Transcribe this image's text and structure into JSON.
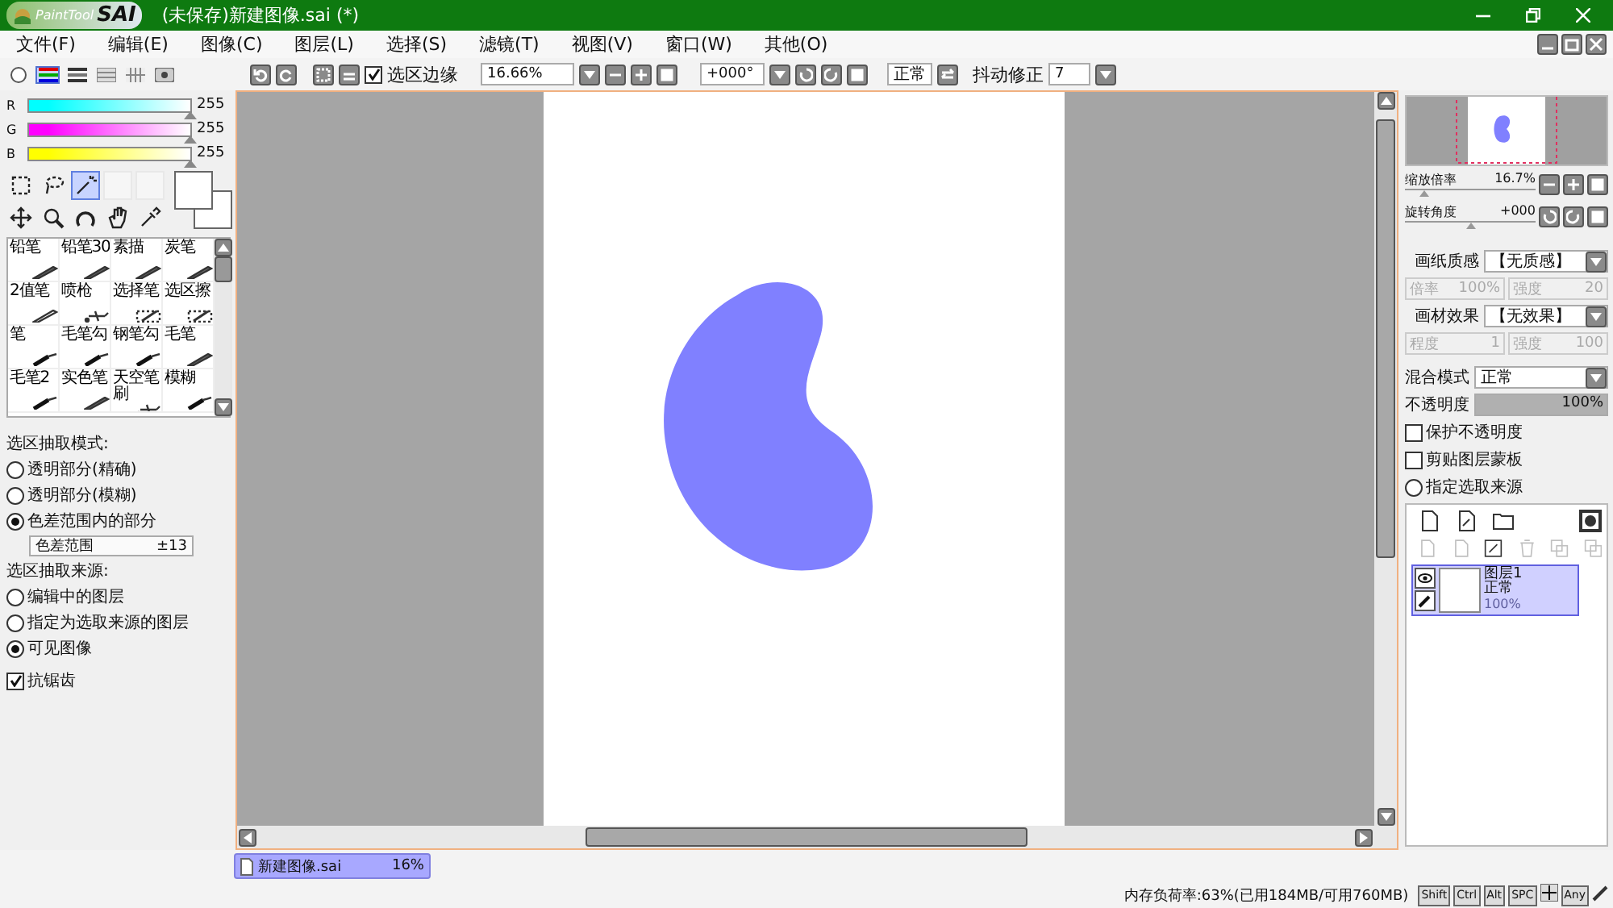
{
  "window": {
    "logo_text": "PaintTool",
    "logo_name": "SAI",
    "title": "(未保存)新建图像.sai (*)"
  },
  "menu": [
    "文件(F)",
    "编辑(E)",
    "图像(C)",
    "图层(L)",
    "选择(S)",
    "滤镜(T)",
    "视图(V)",
    "窗口(W)",
    "其他(O)"
  ],
  "toolbar": {
    "show_selection": {
      "label": "选区边缘",
      "checked": true
    },
    "zoom": "16.66%",
    "rotation": "+000°",
    "blend": "正常",
    "stabilizer": {
      "label": "抖动修正",
      "value": "7"
    }
  },
  "color_modes": [
    {
      "kind": "wheel",
      "selected": false
    },
    {
      "kind": "rgb",
      "selected": true
    },
    {
      "kind": "hsv",
      "selected": false
    },
    {
      "kind": "mixer",
      "selected": false
    },
    {
      "kind": "swatch",
      "selected": false
    },
    {
      "kind": "scratch",
      "selected": false
    }
  ],
  "rgb": [
    {
      "name": "R",
      "level": 1,
      "reading": "255",
      "color": "#00ffff"
    },
    {
      "name": "G",
      "level": 1,
      "reading": "255",
      "color": "#ff00ff"
    },
    {
      "name": "B",
      "level": 1,
      "reading": "255",
      "color": "#ffff00"
    }
  ],
  "tools": [
    {
      "kind": "rect-select",
      "selected": false
    },
    {
      "kind": "lasso",
      "selected": false
    },
    {
      "kind": "wand",
      "selected": true
    },
    {
      "kind": "blank",
      "selected": false
    },
    {
      "kind": "blank",
      "selected": false
    },
    {
      "kind": "move",
      "selected": false
    },
    {
      "kind": "zoom",
      "selected": false
    },
    {
      "kind": "rotate",
      "selected": false
    },
    {
      "kind": "hand",
      "selected": false
    },
    {
      "kind": "eyedropper",
      "selected": false
    }
  ],
  "brushes": [
    {
      "label": "铅笔",
      "kind": "pencil"
    },
    {
      "label": "铅笔30",
      "kind": "pencil"
    },
    {
      "label": "素描",
      "kind": "pencil"
    },
    {
      "label": "炭笔",
      "kind": "pencil"
    },
    {
      "label": "2值笔",
      "kind": "outline"
    },
    {
      "label": "喷枪",
      "kind": "airbrush"
    },
    {
      "label": "选择笔",
      "kind": "select"
    },
    {
      "label": "选区擦",
      "kind": "select"
    },
    {
      "label": "笔",
      "kind": "pen"
    },
    {
      "label": "毛笔勾",
      "kind": "pen"
    },
    {
      "label": "钢笔勾",
      "kind": "pen"
    },
    {
      "label": "毛笔",
      "kind": "pencil"
    },
    {
      "label": "毛笔2",
      "kind": "pen"
    },
    {
      "label": "实色笔",
      "kind": "pencil"
    },
    {
      "label": "天空笔刷",
      "kind": "airbrush"
    },
    {
      "label": "模糊",
      "kind": "pen"
    }
  ],
  "selection_panel": {
    "mode_heading": "选区抽取模式:",
    "modes": [
      {
        "label": "透明部分(精确)",
        "selected": false
      },
      {
        "label": "透明部分(模糊)",
        "selected": false
      },
      {
        "label": "色差范围内的部分",
        "selected": true
      }
    ],
    "range": {
      "label": "色差范围",
      "value": "±13"
    },
    "source_heading": "选区抽取来源:",
    "sources": [
      {
        "label": "编辑中的图层",
        "selected": false
      },
      {
        "label": "指定为选取来源的图层",
        "selected": false
      },
      {
        "label": "可见图像",
        "selected": true
      }
    ],
    "antialias": {
      "label": "抗锯齿",
      "checked": true
    }
  },
  "navigator": {
    "zoom": {
      "label": "缩放倍率",
      "value": "16.7%",
      "level": 0.15
    },
    "rotation": {
      "label": "旋转角度",
      "value": "+000",
      "level": 0.5
    }
  },
  "paper_texture": {
    "label": "画纸质感",
    "value": "【无质感】",
    "disabled": true,
    "fields": [
      {
        "label": "倍率",
        "value": "100%"
      },
      {
        "label": "强度",
        "value": "20"
      }
    ]
  },
  "brush_texture": {
    "label": "画材效果",
    "value": "【无效果】",
    "disabled": true,
    "fields": [
      {
        "label": "程度",
        "value": "1"
      },
      {
        "label": "强度",
        "value": "100"
      }
    ]
  },
  "layer_settings": {
    "blend_label": "混合模式",
    "blend": "正常",
    "opacity_label": "不透明度",
    "opacity": "100%",
    "level": 1,
    "options": [
      {
        "kind": "checkbox",
        "label": "保护不透明度",
        "checked": false
      },
      {
        "kind": "checkbox",
        "label": "剪贴图层蒙板",
        "checked": false
      },
      {
        "kind": "radio",
        "label": "指定选取来源",
        "checked": false
      }
    ]
  },
  "layers": [
    {
      "name": "图层1",
      "mode": "正常",
      "opacity": "100%",
      "selected": true,
      "visible": true
    }
  ],
  "documents": [
    {
      "name": "新建图像.sai",
      "zoom": "16%",
      "selected": true
    }
  ],
  "status": {
    "memory": "内存负荷率:63%(已用184MB/可用760MB)",
    "keys": [
      "Shift",
      "Ctrl",
      "Alt",
      "SPC"
    ],
    "any": "Any"
  }
}
